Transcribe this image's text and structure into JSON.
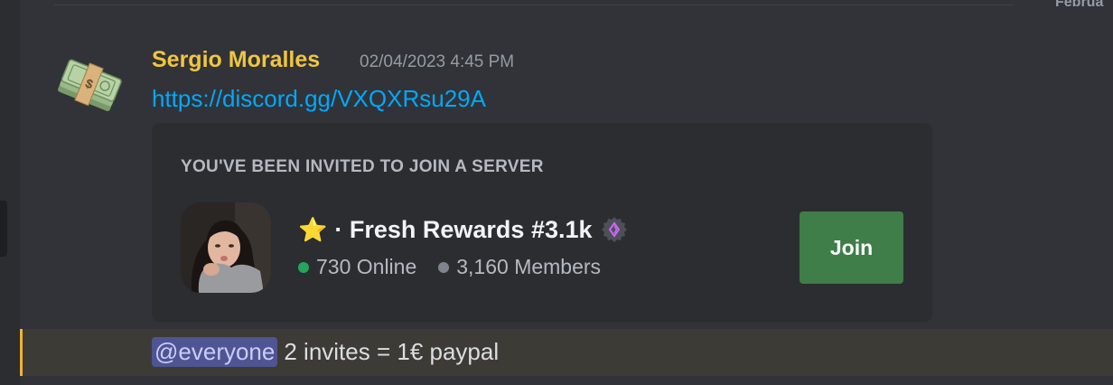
{
  "divider": {
    "date_label": "Februa"
  },
  "message": {
    "author": "Sergio Moralles",
    "timestamp": "02/04/2023 4:45 PM",
    "link": "https://discord.gg/VXQXRsu29A",
    "avatar_icon": "money-stack-icon",
    "author_color": "#f0c540"
  },
  "invite": {
    "heading": "YOU'VE BEEN INVITED TO JOIN A SERVER",
    "server_emoji": "⭐",
    "server_name": "· Fresh Rewards #3.1k",
    "badge_icon": "partner-badge-icon",
    "online": "730 Online",
    "members": "3,160 Members",
    "join_label": "Join",
    "join_color": "#3f7d49"
  },
  "mention_message": {
    "mention": "@everyone",
    "text": "2 invites = 1€ paypal",
    "highlight_color": "#f0b232"
  }
}
